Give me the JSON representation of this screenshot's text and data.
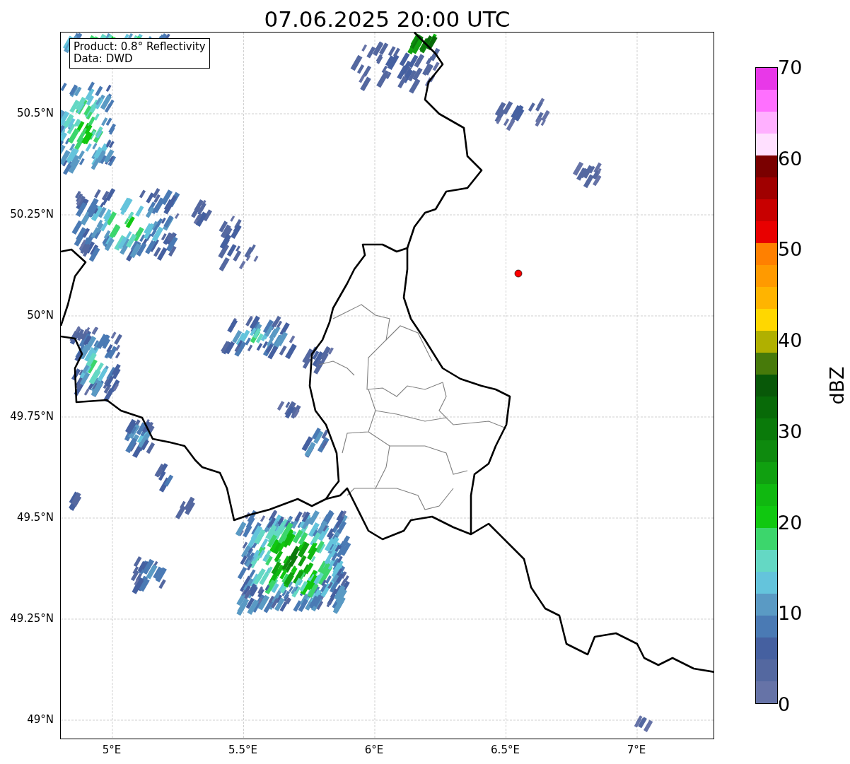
{
  "title": "07.06.2025 20:00 UTC",
  "info": [
    "Product: 0.8° Reflectivity",
    "Data: DWD"
  ],
  "lat_labels": [
    "50.5°N",
    "50.25°N",
    "50°N",
    "49.75°N",
    "49.5°N",
    "49.25°N",
    "49°N"
  ],
  "lon_labels": [
    "5°E",
    "5.5°E",
    "6°E",
    "6.5°E",
    "7°E"
  ],
  "colorbar": {
    "label": "dBZ",
    "ticks": [
      "70",
      "60",
      "50",
      "40",
      "30",
      "20",
      "10",
      "0"
    ],
    "segments": [
      {
        "color": "#6673a7"
      },
      {
        "color": "#5468a0"
      },
      {
        "color": "#4560a0"
      },
      {
        "color": "#4a7ab4"
      },
      {
        "color": "#5a9ac4"
      },
      {
        "color": "#64c4dc"
      },
      {
        "color": "#64d8c4"
      },
      {
        "color": "#3cd66c"
      },
      {
        "color": "#10c810"
      },
      {
        "color": "#10b810"
      },
      {
        "color": "#10a010"
      },
      {
        "color": "#0e8a0e"
      },
      {
        "color": "#0a7a0a"
      },
      {
        "color": "#086a08"
      },
      {
        "color": "#085808"
      },
      {
        "color": "#477a0a"
      },
      {
        "color": "#b0b000"
      },
      {
        "color": "#ffd700"
      },
      {
        "color": "#ffb400"
      },
      {
        "color": "#ff9a00"
      },
      {
        "color": "#ff8000"
      },
      {
        "color": "#e80000"
      },
      {
        "color": "#c80000"
      },
      {
        "color": "#a00000"
      },
      {
        "color": "#7a0000"
      },
      {
        "color": "#ffe0ff"
      },
      {
        "color": "#ffb0ff"
      },
      {
        "color": "#ff70ff"
      },
      {
        "color": "#e838e8"
      }
    ]
  }
}
